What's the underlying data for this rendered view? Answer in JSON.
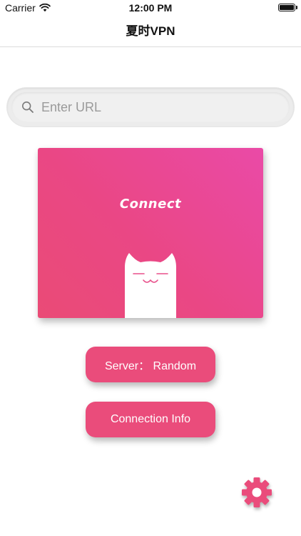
{
  "status_bar": {
    "carrier": "Carrier",
    "time": "12:00 PM",
    "wifi_icon": "wifi-icon",
    "battery_icon": "battery-icon",
    "battery_level": 1.0
  },
  "nav": {
    "title": "夏时VPN"
  },
  "search": {
    "placeholder": "Enter URL",
    "value": "",
    "icon": "search-icon"
  },
  "connect_card": {
    "label": "Connect",
    "mascot": "cat-mascot",
    "gradient": [
      "#ea4aa7",
      "#ea4b76"
    ]
  },
  "buttons": {
    "server_label": "Server： Random",
    "info_label": "Connection Info"
  },
  "settings": {
    "icon": "gear-icon"
  },
  "colors": {
    "accent": "#ea4c7b",
    "background": "#ffffff",
    "text": "#111111"
  }
}
